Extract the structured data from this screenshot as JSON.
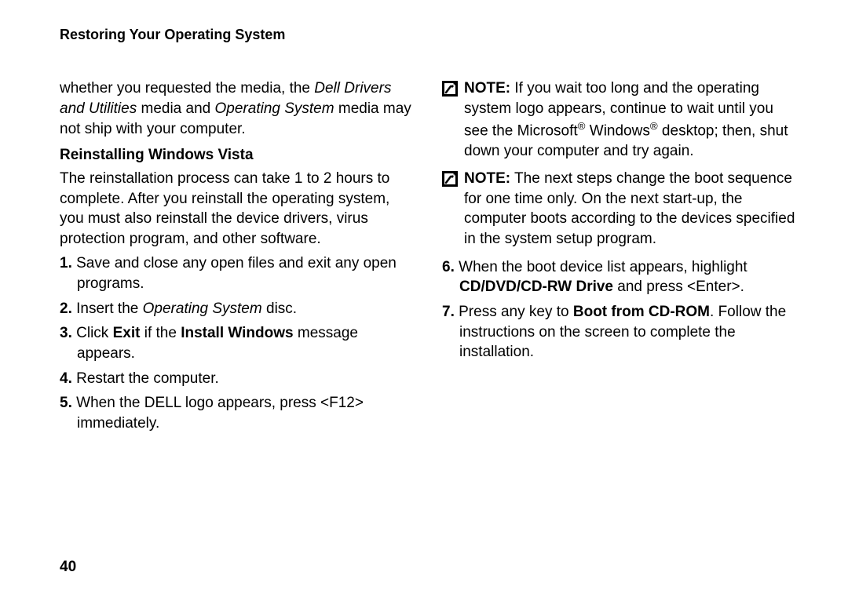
{
  "header": "Restoring Your Operating System",
  "left": {
    "carryover_pre": "whether you requested the media, the ",
    "carryover_em1": "Dell Drivers and Utilities",
    "carryover_mid1": " media and ",
    "carryover_em2": "Operating System",
    "carryover_post": " media may not ship with your computer.",
    "subhead": "Reinstalling Windows Vista",
    "intro": "The reinstallation process can take 1 to 2 hours to complete. After you reinstall the operating system, you must also reinstall the device drivers, virus protection program, and other software.",
    "step1_num": "1.",
    "step1": " Save and close any open files and exit any open programs.",
    "step2_num": "2.",
    "step2_pre": " Insert the ",
    "step2_em": "Operating System",
    "step2_post": " disc.",
    "step3_num": "3.",
    "step3_pre": " Click ",
    "step3_b1": "Exit",
    "step3_mid": " if the ",
    "step3_b2": "Install Windows",
    "step3_post": " message appears.",
    "step4_num": "4.",
    "step4": " Restart the computer.",
    "step5_num": "5.",
    "step5": " When the DELL logo appears, press <F12> immediately."
  },
  "right": {
    "note1_label": "NOTE:",
    "note1_pre": " If you wait too long and the operating system logo appears, continue to wait until you see the Microsoft",
    "note1_reg1": "®",
    "note1_mid": " Windows",
    "note1_reg2": "®",
    "note1_post": " desktop; then, shut down your computer and try again.",
    "note2_label": "NOTE:",
    "note2": " The next steps change the boot sequence for one time only. On the next start-up, the computer boots according to the devices specified in the system setup program.",
    "step6_num": "6.",
    "step6_pre": " When the boot device list appears, highlight ",
    "step6_bold": "CD/DVD/CD-RW Drive",
    "step6_post": " and press <Enter>.",
    "step7_num": "7.",
    "step7_pre": " Press any key to ",
    "step7_bold": "Boot from CD-ROM",
    "step7_post": ". Follow the instructions on the screen to complete the installation."
  },
  "page_number": "40",
  "icons": {
    "note": "note-icon"
  }
}
